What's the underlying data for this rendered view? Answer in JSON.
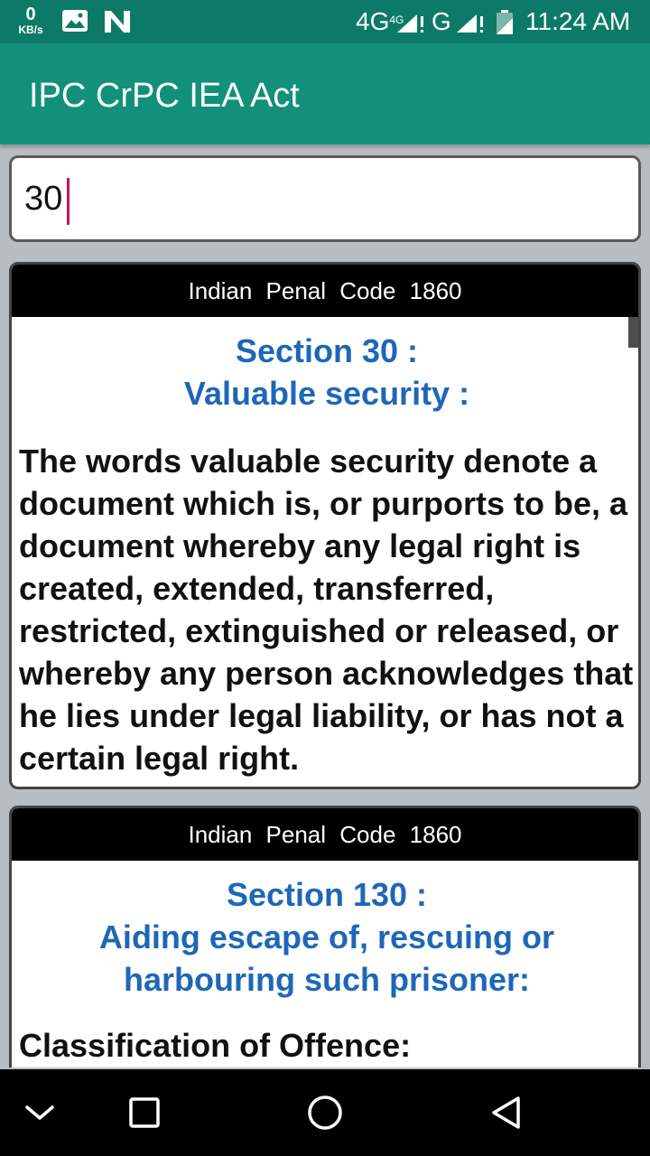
{
  "status_bar": {
    "speed_value": "0",
    "speed_unit": "KB/s",
    "network_1": "4G",
    "network_1_sup": "4G",
    "network_2": "G",
    "time": "11:24 AM",
    "icons": [
      "image-icon",
      "n-notification-icon",
      "signal-icon",
      "signal-icon",
      "battery-icon"
    ]
  },
  "app_bar": {
    "title": "IPC CrPC IEA Act"
  },
  "search": {
    "value": "30"
  },
  "results": [
    {
      "header": "Indian Penal Code 1860",
      "title": "Section 30 :",
      "subtitle": "Valuable security :",
      "text": "The words valuable security denote a document which is, or purports to be, a document whereby any legal right is created, extended, transferred, restricted, extinguished or released, or whereby any person acknowledges that he lies under legal liability, or has not a certain legal right."
    },
    {
      "header": "Indian Penal Code 1860",
      "title": "Section 130 :",
      "subtitle": "Aiding escape of, rescuing or harbouring such prisoner:",
      "text": "Classification of Offence:"
    }
  ],
  "nav_bar": {
    "icons": [
      "chevron-down-icon",
      "recents-square-icon",
      "home-circle-icon",
      "back-triangle-icon"
    ]
  },
  "colors": {
    "status_bar": "#0d7a68",
    "app_bar": "#12907a",
    "section_title": "#1e67b8",
    "caret": "#c2185b"
  }
}
